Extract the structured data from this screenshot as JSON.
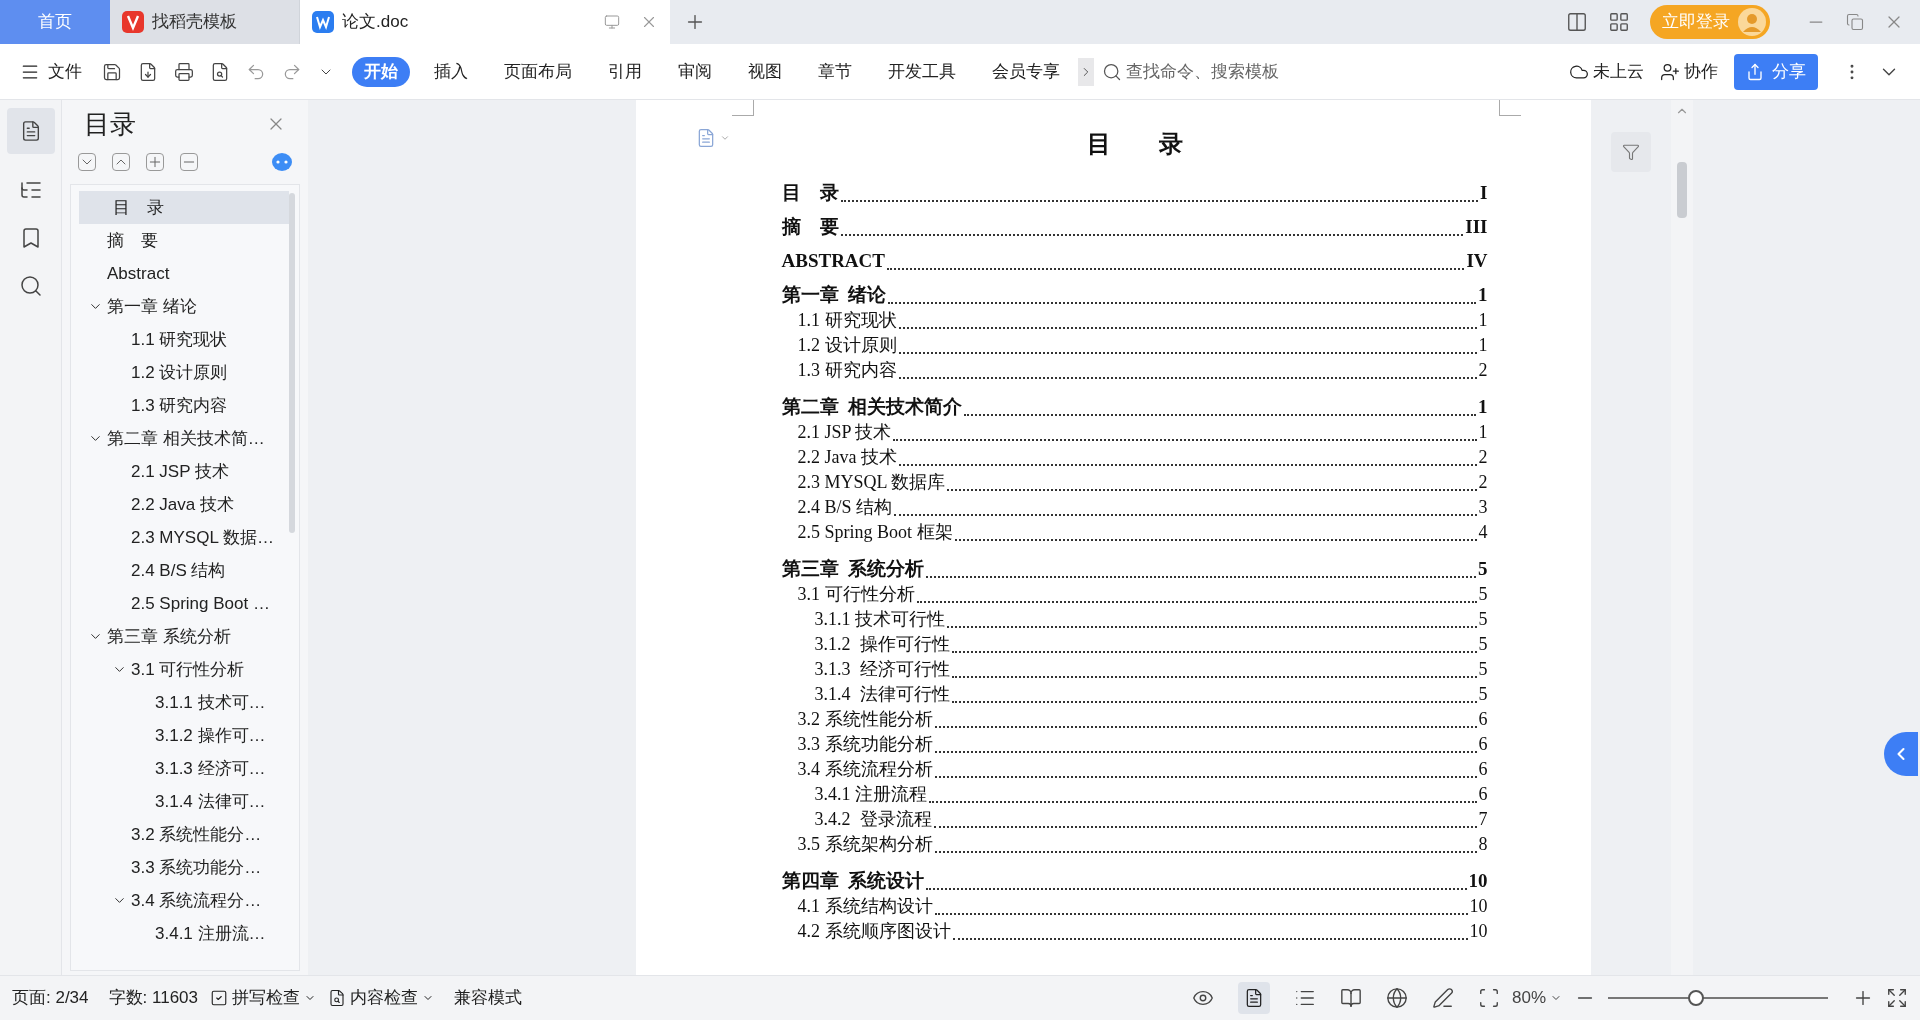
{
  "tabs": [
    {
      "label": "首页",
      "kind": "home",
      "selected": false
    },
    {
      "label": "找稻壳模板",
      "kind": "docer",
      "selected": false
    },
    {
      "label": "论文.doc",
      "kind": "doc",
      "selected": true
    }
  ],
  "login_button": "立即登录",
  "ribbon": {
    "file_menu": "文件",
    "tabs": [
      {
        "label": "开始",
        "selected": true
      },
      {
        "label": "插入",
        "selected": false
      },
      {
        "label": "页面布局",
        "selected": false
      },
      {
        "label": "引用",
        "selected": false
      },
      {
        "label": "审阅",
        "selected": false
      },
      {
        "label": "视图",
        "selected": false
      },
      {
        "label": "章节",
        "selected": false
      },
      {
        "label": "开发工具",
        "selected": false
      },
      {
        "label": "会员专享",
        "selected": false
      }
    ],
    "search": {
      "placeholder": "查找命令、搜索模板"
    },
    "cloud": "未上云",
    "collab": "协作",
    "share": "分享"
  },
  "nav_pane": {
    "title": "目录",
    "items": [
      {
        "label": "目　录",
        "selected": true
      },
      {
        "label": "摘　要",
        "selected": false
      },
      {
        "label": "Abstract",
        "selected": false
      },
      {
        "label": "第一章  绪论",
        "selected": false,
        "expanded": true,
        "children": [
          {
            "label": "1.1  研究现状",
            "selected": false
          },
          {
            "label": "1.2  设计原则",
            "selected": false
          },
          {
            "label": "1.3  研究内容",
            "selected": false
          }
        ]
      },
      {
        "label": "第二章  相关技术简…",
        "selected": false,
        "expanded": true,
        "children": [
          {
            "label": "2.1 JSP 技术",
            "selected": false
          },
          {
            "label": "2.2 Java 技术",
            "selected": false
          },
          {
            "label": "2.3 MYSQL 数据…",
            "selected": false
          },
          {
            "label": "2.4 B/S 结构",
            "selected": false
          },
          {
            "label": "2.5 Spring Boot …",
            "selected": false
          }
        ]
      },
      {
        "label": "第三章  系统分析",
        "selected": false,
        "expanded": true,
        "children": [
          {
            "label": "3.1 可行性分析",
            "selected": false,
            "expanded": true,
            "children": [
              {
                "label": "3.1.1 技术可…",
                "selected": false
              },
              {
                "label": "3.1.2  操作可…",
                "selected": false
              },
              {
                "label": "3.1.3  经济可…",
                "selected": false
              },
              {
                "label": "3.1.4  法律可…",
                "selected": false
              }
            ]
          },
          {
            "label": "3.2 系统性能分…",
            "selected": false
          },
          {
            "label": "3.3 系统功能分…",
            "selected": false
          },
          {
            "label": "3.4 系统流程分…",
            "selected": false,
            "expanded": true,
            "children": [
              {
                "label": "3.4.1 注册流…",
                "selected": false
              }
            ]
          }
        ]
      }
    ]
  },
  "document": {
    "heading": "目　　录",
    "toc": [
      {
        "kind": "chapter",
        "text": "目　录",
        "page": "I"
      },
      {
        "kind": "chapter",
        "text": "摘　要",
        "page": "III"
      },
      {
        "kind": "chapter",
        "text": "ABSTRACT",
        "page": "IV"
      },
      {
        "kind": "chapter",
        "text": "第一章  绪论",
        "page": "1"
      },
      {
        "kind": "section",
        "text": "1.1 研究现状",
        "page": "1"
      },
      {
        "kind": "section",
        "text": "1.2 设计原则",
        "page": "1"
      },
      {
        "kind": "section",
        "text": "1.3 研究内容",
        "page": "2"
      },
      {
        "kind": "chapter",
        "text": "第二章  相关技术简介",
        "page": "1"
      },
      {
        "kind": "section",
        "text": "2.1 JSP 技术",
        "page": "1"
      },
      {
        "kind": "section",
        "text": "2.2 Java 技术",
        "page": "2"
      },
      {
        "kind": "section",
        "text": "2.3 MYSQL 数据库",
        "page": "2"
      },
      {
        "kind": "section",
        "text": "2.4 B/S 结构",
        "page": "3"
      },
      {
        "kind": "section",
        "text": "2.5 Spring Boot 框架",
        "page": "4"
      },
      {
        "kind": "chapter",
        "text": "第三章  系统分析",
        "page": "5"
      },
      {
        "kind": "section",
        "text": "3.1 可行性分析",
        "page": "5"
      },
      {
        "kind": "subsection",
        "text": "3.1.1 技术可行性",
        "page": "5"
      },
      {
        "kind": "subsection",
        "text": "3.1.2  操作可行性",
        "page": "5"
      },
      {
        "kind": "subsection",
        "text": "3.1.3  经济可行性",
        "page": "5"
      },
      {
        "kind": "subsection",
        "text": "3.1.4  法律可行性",
        "page": "5"
      },
      {
        "kind": "section",
        "text": "3.2 系统性能分析",
        "page": "6"
      },
      {
        "kind": "section",
        "text": "3.3 系统功能分析",
        "page": "6"
      },
      {
        "kind": "section",
        "text": "3.4 系统流程分析",
        "page": "6"
      },
      {
        "kind": "subsection",
        "text": "3.4.1 注册流程",
        "page": "6"
      },
      {
        "kind": "subsection",
        "text": "3.4.2  登录流程",
        "page": "7"
      },
      {
        "kind": "section",
        "text": "3.5 系统架构分析",
        "page": "8"
      },
      {
        "kind": "chapter",
        "text": "第四章  系统设计",
        "page": "10"
      },
      {
        "kind": "section",
        "text": "4.1 系统结构设计",
        "page": "10"
      },
      {
        "kind": "section",
        "text": "4.2 系统顺序图设计",
        "page": "10"
      }
    ]
  },
  "status_bar": {
    "page": "页面: 2/34",
    "words": "字数: 11603",
    "spell_check": "拼写检查",
    "content_check": "内容检查",
    "compat": "兼容模式",
    "zoom": "80%",
    "zoom_slider": {
      "level": 0.4
    }
  }
}
